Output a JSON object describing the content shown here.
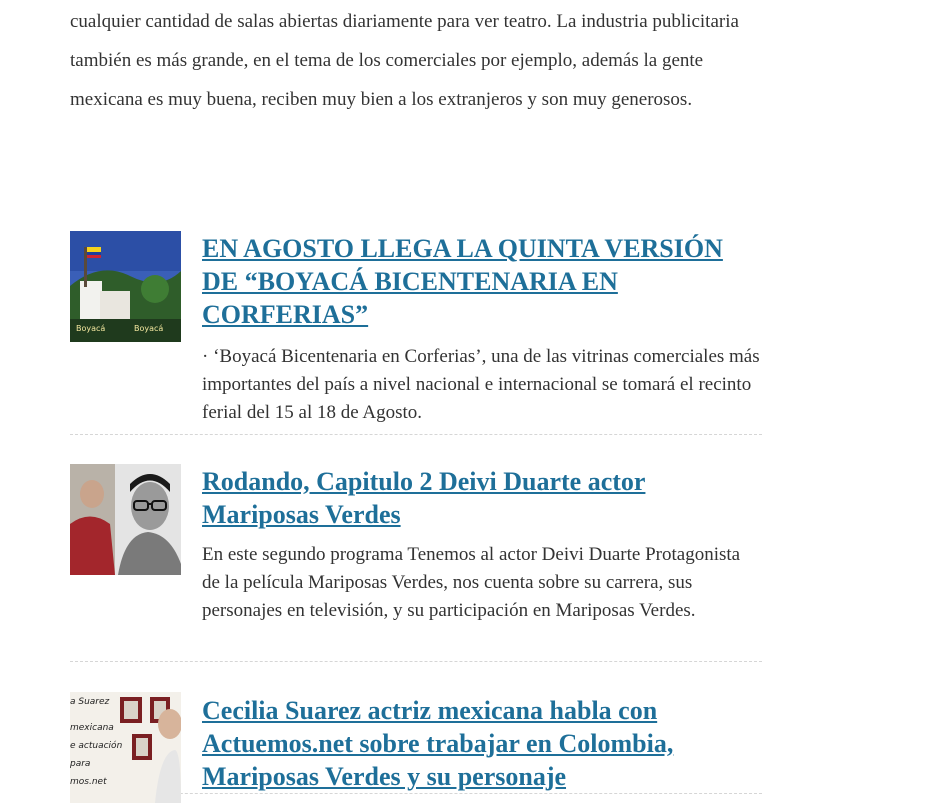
{
  "intro": {
    "text": "cualquier cantidad de salas abiertas diariamente para ver teatro. La industria publicitaria también es más grande, en el tema de los comerciales por ejemplo, además la gente mexicana es muy buena, reciben muy bien a los extranjeros y son muy generosos."
  },
  "posts": [
    {
      "title": "EN AGOSTO LLEGA LA QUINTA VERSIÓN DE “BOYACÁ BICENTENARIA EN CORFERIAS”",
      "excerpt": "·         ‘Boyacá Bicentenaria en Corferias’, una de las vitrinas comerciales más importantes del país a nivel nacional e internacional se tomará el recinto ferial del 15 al 18 de Agosto.",
      "thumb_labels": [
        "Boyacá",
        "Boyacá"
      ]
    },
    {
      "title": "Rodando, Capitulo 2 Deivi Duarte actor Mariposas Verdes",
      "excerpt": "En este segundo programa Tenemos al actor Deivi Duarte Protagonista de la película Mariposas Verdes, nos cuenta sobre su carrera, sus personajes en televisión, y su participación en Mariposas Verdes."
    },
    {
      "title": "Cecilia Suarez actriz mexicana habla con Actuemos.net sobre trabajar en Colombia, Mariposas Verdes y su personaje",
      "thumb_labels": [
        "a Suarez",
        "mexicana",
        "e actuación",
        "para",
        "mos.net"
      ]
    }
  ],
  "colors": {
    "link": "#1e6f99",
    "text": "#333333",
    "divider": "#d6d6d6"
  }
}
